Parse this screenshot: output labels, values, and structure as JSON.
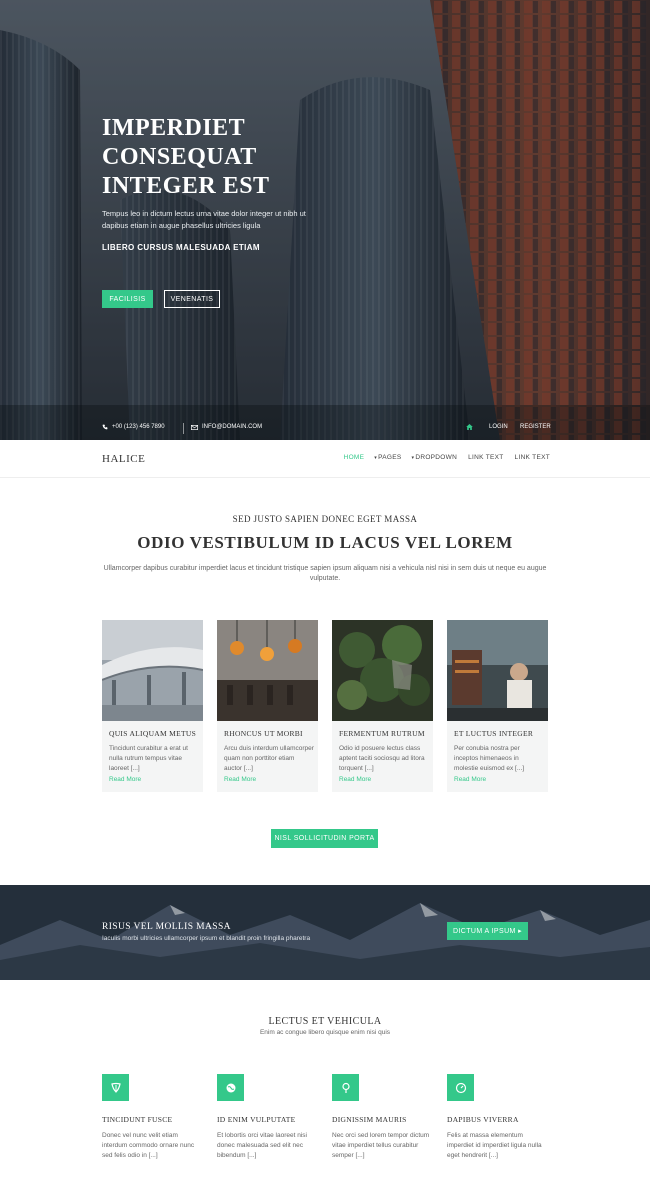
{
  "hero": {
    "title_lines": [
      "IMPERDIET",
      "CONSEQUAT",
      "INTEGER EST"
    ],
    "text": "Tempus leo in dictum lectus urna vitae dolor integer ut nibh ut dapibus etiam in augue phasellus ultricies ligula",
    "subtitle": "LIBERO CURSUS MALESUADA ETIAM",
    "primary_button": "FACILISIS",
    "secondary_button": "VENENATIS"
  },
  "topbar": {
    "phone": "+00 (123) 456 7890",
    "email": "INFO@DOMAIN.COM",
    "login": "LOGIN",
    "register": "REGISTER"
  },
  "nav": {
    "logo": "HALICE",
    "items": [
      {
        "label": "HOME",
        "caret": ""
      },
      {
        "label": "PAGES",
        "caret": "▾"
      },
      {
        "label": "DROPDOWN",
        "caret": "▾"
      },
      {
        "label": "LINK TEXT",
        "caret": ""
      },
      {
        "label": "LINK TEXT",
        "caret": ""
      }
    ]
  },
  "intro": {
    "kicker": "SED JUSTO SAPIEN DONEC EGET MASSA",
    "title": "ODIO VESTIBULUM ID LACUS VEL LOREM",
    "text": "Ullamcorper dapibus curabitur imperdiet lacus et tincidunt tristique sapien ipsum aliquam nisi a vehicula nisl nisi in sem duis ut neque eu augue vulputate."
  },
  "cards": [
    {
      "title": "QUIS ALIQUAM METUS",
      "text": "Tincidunt curabitur a erat ut nulla rutrum tempus vitae laoreet [...]",
      "more": "Read More"
    },
    {
      "title": "RHONCUS UT MORBI",
      "text": "Arcu duis interdum ullamcorper quam non porttitor etiam auctor [...]",
      "more": "Read More"
    },
    {
      "title": "FERMENTUM RUTRUM",
      "text": "Odio id posuere lectus class aptent taciti sociosqu ad litora torquent [...]",
      "more": "Read More"
    },
    {
      "title": "ET LUCTUS INTEGER",
      "text": "Per conubia nostra per inceptos himenaeos in molestie euismod ex [...]",
      "more": "Read More"
    }
  ],
  "more_button": "NISL SOLLICITUDIN PORTA",
  "cta": {
    "title": "RISUS VEL MOLLIS MASSA",
    "text": "Iaculis morbi ultricies ullamcorper ipsum et blandit proin fringilla pharetra",
    "button": "DICTUM A IPSUM ▸"
  },
  "features": {
    "title": "LECTUS ET VEHICULA",
    "subtitle": "Enim ac congue libero quisque enim nisi quis",
    "items": [
      {
        "icon": "leaf-icon",
        "title": "TINCIDUNT FUSCE",
        "text": "Donec vel nunc velit etiam interdum commodo ornare nunc sed felis odio in [...]"
      },
      {
        "icon": "globe-icon",
        "title": "ID ENIM VULPUTATE",
        "text": "Et lobortis orci vitae laoreet nisi donec malesuada sed elit nec bibendum [...]"
      },
      {
        "icon": "pin-icon",
        "title": "DIGNISSIM MAURIS",
        "text": "Nec orci sed lorem tempor dictum vitae imperdiet tellus curabitur semper [...]"
      },
      {
        "icon": "compass-icon",
        "title": "DAPIBUS VIVERRA",
        "text": "Felis at massa elementum imperdiet id imperdiet ligula nulla eget hendrerit [...]"
      }
    ]
  },
  "colors": {
    "accent": "#34c88a",
    "dark": "#27313d"
  }
}
